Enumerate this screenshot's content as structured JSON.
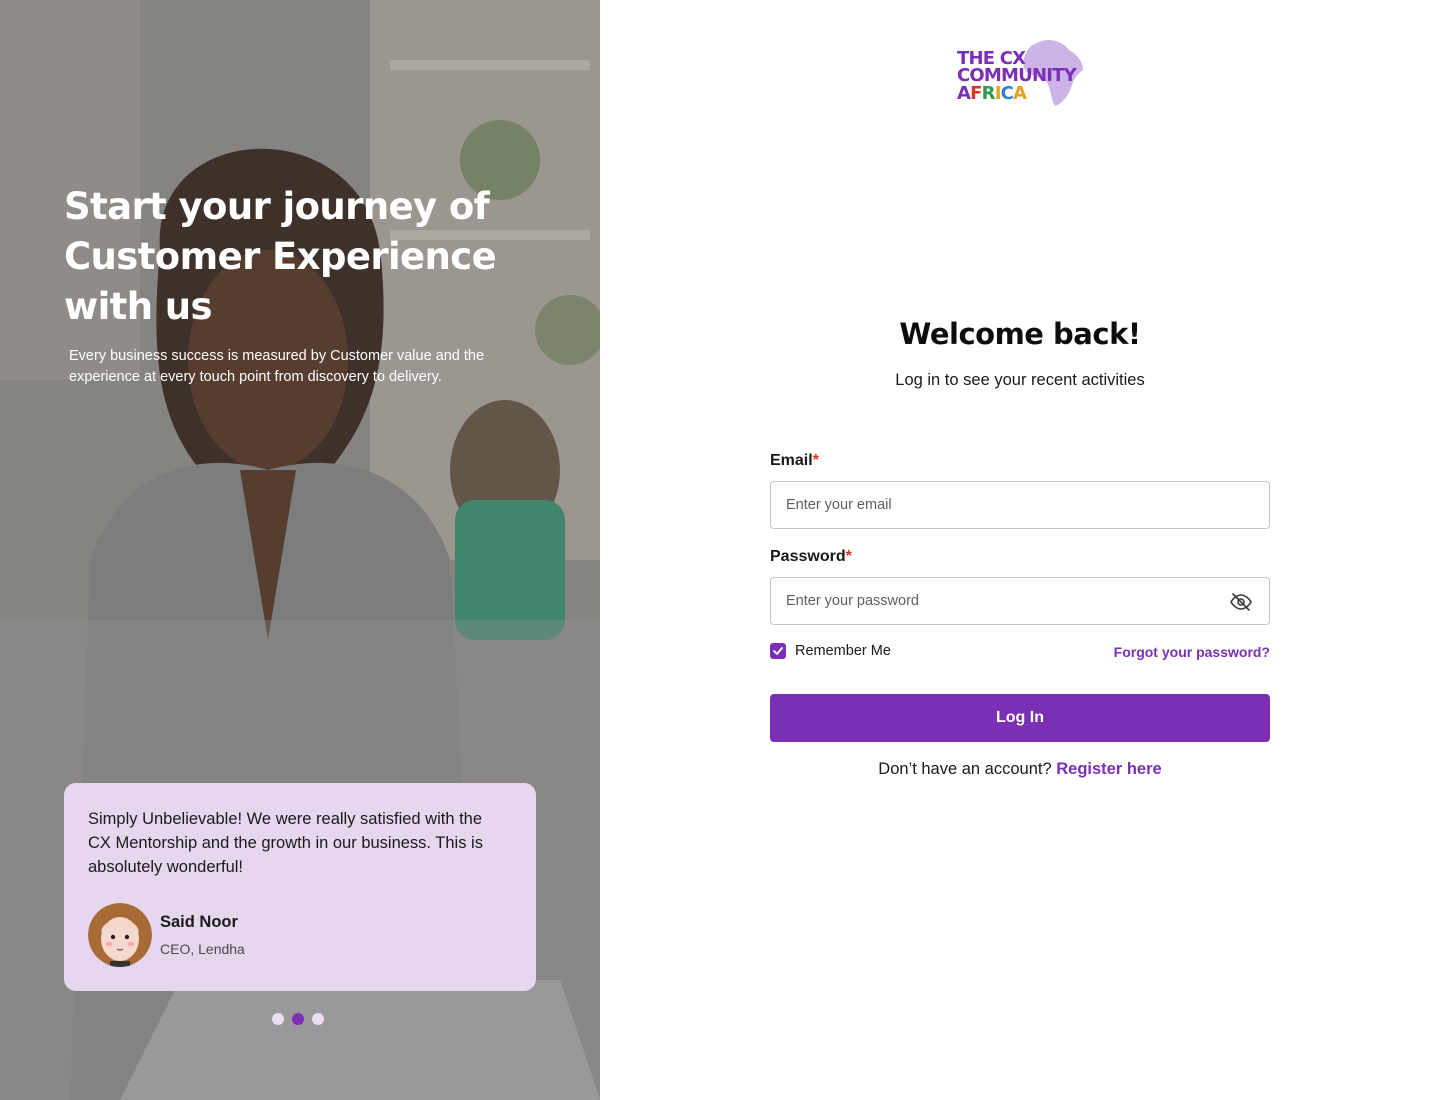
{
  "hero": {
    "title": "Start your journey of Customer Experience with us",
    "subtitle": "Every business success is measured by Customer value and the experience at every touch point from discovery to delivery.",
    "testimonial": {
      "quote": "Simply Unbelievable! We were really satisfied with the CX Mentorship and the growth in our business. This is absolutely wonderful!",
      "name": "Said Noor",
      "role": "CEO, Lendha"
    },
    "carousel": {
      "count": 3,
      "active_index": 1
    }
  },
  "logo": {
    "line1": "THE CX",
    "line2": "COMMUNITY",
    "line3": "AFRICA",
    "line3_colors": [
      "#7a2fb5",
      "#d9332a",
      "#2e9e4a",
      "#e8a020",
      "#2f7fd0",
      "#e8a020"
    ]
  },
  "form": {
    "heading": "Welcome back!",
    "subheading": "Log in to see your recent activities",
    "email": {
      "label": "Email",
      "required_mark": "*",
      "placeholder": "Enter your email",
      "value": ""
    },
    "password": {
      "label": "Password",
      "required_mark": "*",
      "placeholder": "Enter your password",
      "value": "",
      "toggle_icon": "eye-off-icon"
    },
    "remember_me": {
      "label": "Remember Me",
      "checked": true
    },
    "forgot_label": "Forgot your password?",
    "submit_label": "Log In",
    "register_prompt": "Don’t have an account?",
    "register_link": "Register here"
  },
  "colors": {
    "accent": "#7a2fb5",
    "testimonial_bg": "#e6d7ef",
    "required": "#d9332a"
  }
}
